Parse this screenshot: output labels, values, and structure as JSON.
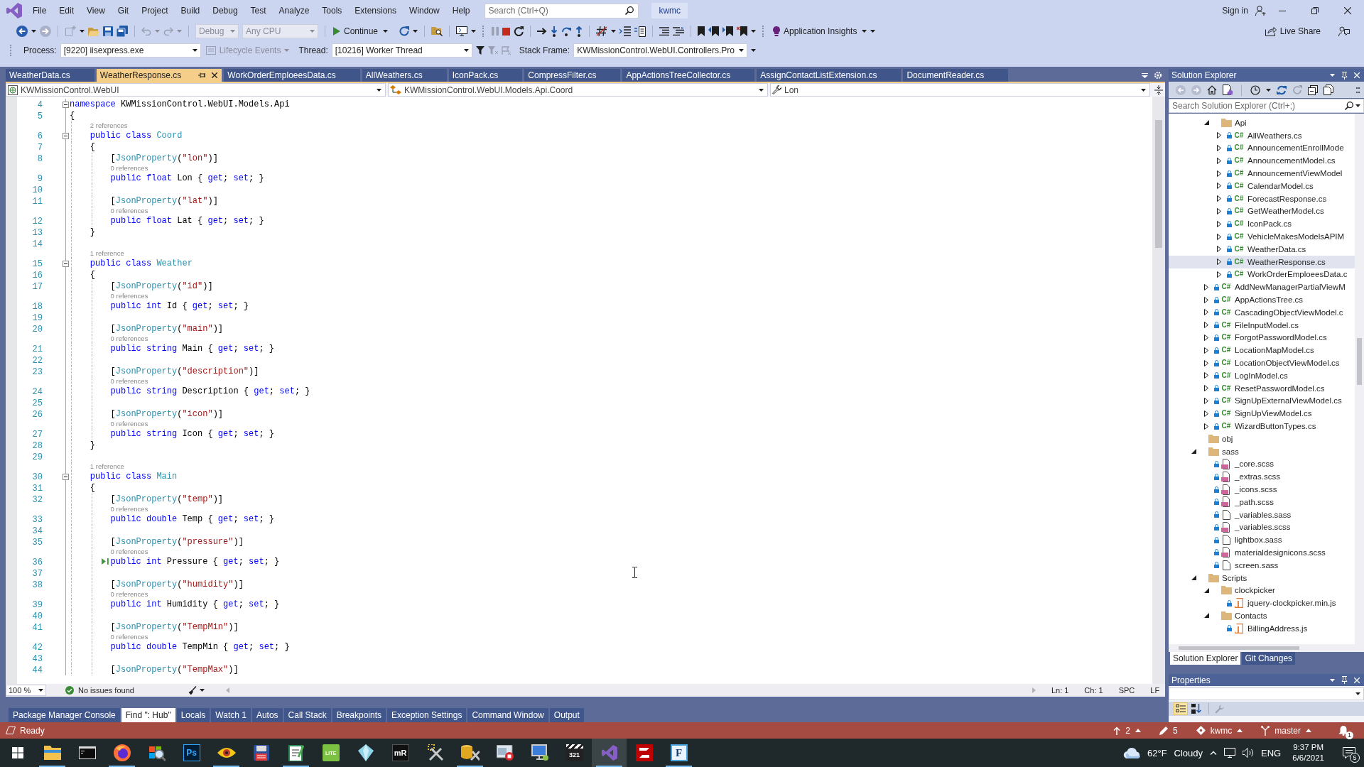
{
  "title_bar": {
    "menu": [
      "File",
      "Edit",
      "View",
      "Git",
      "Project",
      "Build",
      "Debug",
      "Test",
      "Analyze",
      "Tools",
      "Extensions",
      "Window",
      "Help"
    ],
    "search": {
      "placeholder": "Search (Ctrl+Q)"
    },
    "solution_name": "kwmc",
    "sign_in": "Sign in"
  },
  "toolbar": {
    "configuration": {
      "value": "Debug",
      "disabled": true
    },
    "platform": {
      "value": "Any CPU",
      "disabled": true
    },
    "continue": "Continue",
    "insights": "Application Insights",
    "live_share": "Live Share"
  },
  "debug_location": {
    "process_label": "Process:",
    "process": "[9220] iisexpress.exe",
    "lifecycle_events": {
      "label": "Lifecycle Events",
      "disabled": true
    },
    "thread_label": "Thread:",
    "thread": "[10216] Worker Thread",
    "stack_frame_label": "Stack Frame:",
    "stack_frame": "KWMissionControl.WebUI.Controllers.Pro"
  },
  "document_tabs": [
    {
      "label": "WeatherData.cs",
      "selected": false
    },
    {
      "label": "WeatherResponse.cs",
      "selected": true
    },
    {
      "label": "WorkOrderEmploeesData.cs",
      "selected": false
    },
    {
      "label": "AllWeathers.cs",
      "selected": false
    },
    {
      "label": "IconPack.cs",
      "selected": false
    },
    {
      "label": "CompressFilter.cs",
      "selected": false
    },
    {
      "label": "AppActionsTreeCollector.cs",
      "selected": false
    },
    {
      "label": "AssignContactListExtension.cs",
      "selected": false
    },
    {
      "label": "DocumentReader.cs",
      "selected": false
    }
  ],
  "navigation_bar": {
    "project": "KWMissionControl.WebUI",
    "type": "KWMissionControl.WebUI.Models.Api.Coord",
    "member": "Lon"
  },
  "editor": {
    "lines": [
      {
        "number": "4",
        "fold": true,
        "run_to_click": false,
        "tokens": [
          {
            "kind": "keyword",
            "text": "namespace"
          },
          {
            "kind": "plain",
            "text": " KWMissionControl.WebUI.Models.Api"
          }
        ]
      },
      {
        "number": "5",
        "fold": false,
        "run_to_click": false,
        "tokens": [
          {
            "kind": "plain",
            "text": "{"
          }
        ]
      },
      {
        "number": "6",
        "lens": "2 references",
        "fold": true,
        "run_to_click": false,
        "tokens": [
          {
            "kind": "keyword",
            "text": "    public class "
          },
          {
            "kind": "type",
            "text": "Coord"
          }
        ]
      },
      {
        "number": "7",
        "fold": false,
        "run_to_click": false,
        "tokens": [
          {
            "kind": "plain",
            "text": "    {"
          }
        ]
      },
      {
        "number": "8",
        "fold": false,
        "run_to_click": false,
        "tokens": [
          {
            "kind": "plain",
            "text": "        ["
          },
          {
            "kind": "type",
            "text": "JsonProperty"
          },
          {
            "kind": "plain",
            "text": "("
          },
          {
            "kind": "string",
            "text": "\"lon\""
          },
          {
            "kind": "plain",
            "text": ")]"
          }
        ]
      },
      {
        "number": "9",
        "lens": "0 references",
        "fold": false,
        "run_to_click": false,
        "tokens": [
          {
            "kind": "keyword",
            "text": "        public float"
          },
          {
            "kind": "plain",
            "text": " Lon { "
          },
          {
            "kind": "keyword",
            "text": "get"
          },
          {
            "kind": "plain",
            "text": "; "
          },
          {
            "kind": "keyword",
            "text": "set"
          },
          {
            "kind": "plain",
            "text": "; }"
          }
        ]
      },
      {
        "number": "10",
        "fold": false,
        "run_to_click": false
      },
      {
        "number": "11",
        "fold": false,
        "run_to_click": false,
        "tokens": [
          {
            "kind": "plain",
            "text": "        ["
          },
          {
            "kind": "type",
            "text": "JsonProperty"
          },
          {
            "kind": "plain",
            "text": "("
          },
          {
            "kind": "string",
            "text": "\"lat\""
          },
          {
            "kind": "plain",
            "text": ")]"
          }
        ]
      },
      {
        "number": "12",
        "lens": "0 references",
        "fold": false,
        "run_to_click": false,
        "tokens": [
          {
            "kind": "keyword",
            "text": "        public float"
          },
          {
            "kind": "plain",
            "text": " Lat { "
          },
          {
            "kind": "keyword",
            "text": "get"
          },
          {
            "kind": "plain",
            "text": "; "
          },
          {
            "kind": "keyword",
            "text": "set"
          },
          {
            "kind": "plain",
            "text": "; }"
          }
        ]
      },
      {
        "number": "13",
        "fold": false,
        "run_to_click": false,
        "tokens": [
          {
            "kind": "plain",
            "text": "    }"
          }
        ]
      },
      {
        "number": "14",
        "fold": false,
        "run_to_click": false
      },
      {
        "number": "15",
        "lens": "1 reference",
        "fold": true,
        "run_to_click": false,
        "tokens": [
          {
            "kind": "keyword",
            "text": "    public class "
          },
          {
            "kind": "type",
            "text": "Weather"
          }
        ]
      },
      {
        "number": "16",
        "fold": false,
        "run_to_click": false,
        "tokens": [
          {
            "kind": "plain",
            "text": "    {"
          }
        ]
      },
      {
        "number": "17",
        "fold": false,
        "run_to_click": false,
        "tokens": [
          {
            "kind": "plain",
            "text": "        ["
          },
          {
            "kind": "type",
            "text": "JsonProperty"
          },
          {
            "kind": "plain",
            "text": "("
          },
          {
            "kind": "string",
            "text": "\"id\""
          },
          {
            "kind": "plain",
            "text": ")]"
          }
        ]
      },
      {
        "number": "18",
        "lens": "0 references",
        "fold": false,
        "run_to_click": false,
        "tokens": [
          {
            "kind": "keyword",
            "text": "        public int"
          },
          {
            "kind": "plain",
            "text": " Id { "
          },
          {
            "kind": "keyword",
            "text": "get"
          },
          {
            "kind": "plain",
            "text": "; "
          },
          {
            "kind": "keyword",
            "text": "set"
          },
          {
            "kind": "plain",
            "text": "; }"
          }
        ]
      },
      {
        "number": "19",
        "fold": false,
        "run_to_click": false
      },
      {
        "number": "20",
        "fold": false,
        "run_to_click": false,
        "tokens": [
          {
            "kind": "plain",
            "text": "        ["
          },
          {
            "kind": "type",
            "text": "JsonProperty"
          },
          {
            "kind": "plain",
            "text": "("
          },
          {
            "kind": "string",
            "text": "\"main\""
          },
          {
            "kind": "plain",
            "text": ")]"
          }
        ]
      },
      {
        "number": "21",
        "lens": "0 references",
        "fold": false,
        "run_to_click": false,
        "tokens": [
          {
            "kind": "keyword",
            "text": "        public string"
          },
          {
            "kind": "plain",
            "text": " Main { "
          },
          {
            "kind": "keyword",
            "text": "get"
          },
          {
            "kind": "plain",
            "text": "; "
          },
          {
            "kind": "keyword",
            "text": "set"
          },
          {
            "kind": "plain",
            "text": "; }"
          }
        ]
      },
      {
        "number": "22",
        "fold": false,
        "run_to_click": false
      },
      {
        "number": "23",
        "fold": false,
        "run_to_click": false,
        "tokens": [
          {
            "kind": "plain",
            "text": "        ["
          },
          {
            "kind": "type",
            "text": "JsonProperty"
          },
          {
            "kind": "plain",
            "text": "("
          },
          {
            "kind": "string",
            "text": "\"description\""
          },
          {
            "kind": "plain",
            "text": ")]"
          }
        ]
      },
      {
        "number": "24",
        "lens": "0 references",
        "fold": false,
        "run_to_click": false,
        "tokens": [
          {
            "kind": "keyword",
            "text": "        public string"
          },
          {
            "kind": "plain",
            "text": " Description { "
          },
          {
            "kind": "keyword",
            "text": "get"
          },
          {
            "kind": "plain",
            "text": "; "
          },
          {
            "kind": "keyword",
            "text": "set"
          },
          {
            "kind": "plain",
            "text": "; }"
          }
        ]
      },
      {
        "number": "25",
        "fold": false,
        "run_to_click": false
      },
      {
        "number": "26",
        "fold": false,
        "run_to_click": false,
        "tokens": [
          {
            "kind": "plain",
            "text": "        ["
          },
          {
            "kind": "type",
            "text": "JsonProperty"
          },
          {
            "kind": "plain",
            "text": "("
          },
          {
            "kind": "string",
            "text": "\"icon\""
          },
          {
            "kind": "plain",
            "text": ")]"
          }
        ]
      },
      {
        "number": "27",
        "lens": "0 references",
        "fold": false,
        "run_to_click": false,
        "tokens": [
          {
            "kind": "keyword",
            "text": "        public string"
          },
          {
            "kind": "plain",
            "text": " Icon { "
          },
          {
            "kind": "keyword",
            "text": "get"
          },
          {
            "kind": "plain",
            "text": "; "
          },
          {
            "kind": "keyword",
            "text": "set"
          },
          {
            "kind": "plain",
            "text": "; }"
          }
        ]
      },
      {
        "number": "28",
        "fold": false,
        "run_to_click": false,
        "tokens": [
          {
            "kind": "plain",
            "text": "    }"
          }
        ]
      },
      {
        "number": "29",
        "fold": false,
        "run_to_click": false
      },
      {
        "number": "30",
        "lens": "1 reference",
        "fold": true,
        "run_to_click": false,
        "tokens": [
          {
            "kind": "keyword",
            "text": "    public class "
          },
          {
            "kind": "type",
            "text": "Main"
          }
        ]
      },
      {
        "number": "31",
        "fold": false,
        "run_to_click": false,
        "tokens": [
          {
            "kind": "plain",
            "text": "    {"
          }
        ]
      },
      {
        "number": "32",
        "fold": false,
        "run_to_click": false,
        "tokens": [
          {
            "kind": "plain",
            "text": "        ["
          },
          {
            "kind": "type",
            "text": "JsonProperty"
          },
          {
            "kind": "plain",
            "text": "("
          },
          {
            "kind": "string",
            "text": "\"temp\""
          },
          {
            "kind": "plain",
            "text": ")]"
          }
        ]
      },
      {
        "number": "33",
        "lens": "0 references",
        "fold": false,
        "run_to_click": false,
        "tokens": [
          {
            "kind": "keyword",
            "text": "        public double"
          },
          {
            "kind": "plain",
            "text": " Temp { "
          },
          {
            "kind": "keyword",
            "text": "get"
          },
          {
            "kind": "plain",
            "text": "; "
          },
          {
            "kind": "keyword",
            "text": "set"
          },
          {
            "kind": "plain",
            "text": "; }"
          }
        ]
      },
      {
        "number": "34",
        "fold": false,
        "run_to_click": false
      },
      {
        "number": "35",
        "fold": false,
        "run_to_click": false,
        "tokens": [
          {
            "kind": "plain",
            "text": "        ["
          },
          {
            "kind": "type",
            "text": "JsonProperty"
          },
          {
            "kind": "plain",
            "text": "("
          },
          {
            "kind": "string",
            "text": "\"pressure\""
          },
          {
            "kind": "plain",
            "text": ")]"
          }
        ]
      },
      {
        "number": "36",
        "lens": "0 references",
        "fold": false,
        "run_to_click": true,
        "tokens": [
          {
            "kind": "keyword",
            "text": "        public int"
          },
          {
            "kind": "plain",
            "text": " Pressure { "
          },
          {
            "kind": "keyword",
            "text": "get"
          },
          {
            "kind": "plain",
            "text": "; "
          },
          {
            "kind": "keyword",
            "text": "set"
          },
          {
            "kind": "plain",
            "text": "; }"
          }
        ]
      },
      {
        "number": "37",
        "fold": false,
        "run_to_click": false
      },
      {
        "number": "38",
        "fold": false,
        "run_to_click": false,
        "tokens": [
          {
            "kind": "plain",
            "text": "        ["
          },
          {
            "kind": "type",
            "text": "JsonProperty"
          },
          {
            "kind": "plain",
            "text": "("
          },
          {
            "kind": "string",
            "text": "\"humidity\""
          },
          {
            "kind": "plain",
            "text": ")]"
          }
        ]
      },
      {
        "number": "39",
        "lens": "0 references",
        "fold": false,
        "run_to_click": false,
        "tokens": [
          {
            "kind": "keyword",
            "text": "        public int"
          },
          {
            "kind": "plain",
            "text": " Humidity { "
          },
          {
            "kind": "keyword",
            "text": "get"
          },
          {
            "kind": "plain",
            "text": "; "
          },
          {
            "kind": "keyword",
            "text": "set"
          },
          {
            "kind": "plain",
            "text": "; }"
          }
        ]
      },
      {
        "number": "40",
        "fold": false,
        "run_to_click": false
      },
      {
        "number": "41",
        "fold": false,
        "run_to_click": false,
        "tokens": [
          {
            "kind": "plain",
            "text": "        ["
          },
          {
            "kind": "type",
            "text": "JsonProperty"
          },
          {
            "kind": "plain",
            "text": "("
          },
          {
            "kind": "string",
            "text": "\"TempMin\""
          },
          {
            "kind": "plain",
            "text": ")]"
          }
        ]
      },
      {
        "number": "42",
        "lens": "0 references",
        "fold": false,
        "run_to_click": false,
        "tokens": [
          {
            "kind": "keyword",
            "text": "        public double"
          },
          {
            "kind": "plain",
            "text": " TempMin { "
          },
          {
            "kind": "keyword",
            "text": "get"
          },
          {
            "kind": "plain",
            "text": "; "
          },
          {
            "kind": "keyword",
            "text": "set"
          },
          {
            "kind": "plain",
            "text": "; }"
          }
        ]
      },
      {
        "number": "43",
        "fold": false,
        "run_to_click": false
      },
      {
        "number": "44",
        "fold": false,
        "run_to_click": false,
        "tokens": [
          {
            "kind": "plain",
            "text": "        ["
          },
          {
            "kind": "type",
            "text": "JsonProperty"
          },
          {
            "kind": "plain",
            "text": "("
          },
          {
            "kind": "string",
            "text": "\"TempMax\""
          },
          {
            "kind": "plain",
            "text": ")]"
          }
        ]
      }
    ]
  },
  "editor_status": {
    "zoom": "100 %",
    "issues": "No issues found",
    "line": "Ln: 1",
    "column": "Ch: 1",
    "whitespace": "SPC",
    "line_ending": "LF"
  },
  "tool_tabs": [
    {
      "label": "Package Manager Console",
      "selected": false
    },
    {
      "label": "Find \": Hub\"",
      "selected": true
    },
    {
      "label": "Locals",
      "selected": false
    },
    {
      "label": "Watch 1",
      "selected": false
    },
    {
      "label": "Autos",
      "selected": false
    },
    {
      "label": "Call Stack",
      "selected": false
    },
    {
      "label": "Breakpoints",
      "selected": false
    },
    {
      "label": "Exception Settings",
      "selected": false
    },
    {
      "label": "Command Window",
      "selected": false
    },
    {
      "label": "Output",
      "selected": false
    }
  ],
  "solution_explorer": {
    "title": "Solution Explorer",
    "search": {
      "placeholder": "Search Solution Explorer (Ctrl+;)"
    },
    "tree": [
      {
        "children": [
          {
            "label": "Api",
            "kind": "folder",
            "expanded": true,
            "selected": false,
            "children": [
              {
                "label": "AllWeathers.cs",
                "kind": "csharp",
                "tag": "C#",
                "expanded": false,
                "selected": false
              },
              {
                "label": "AnnouncementEnrollMode",
                "kind": "csharp",
                "tag": "C#",
                "expanded": false,
                "selected": false
              },
              {
                "label": "AnnouncementModel.cs",
                "kind": "csharp",
                "tag": "C#",
                "expanded": false,
                "selected": false
              },
              {
                "label": "AnnouncementViewModel",
                "kind": "csharp",
                "tag": "C#",
                "expanded": false,
                "selected": false
              },
              {
                "label": "CalendarModel.cs",
                "kind": "csharp",
                "tag": "C#",
                "expanded": false,
                "selected": false
              },
              {
                "label": "ForecastResponse.cs",
                "kind": "csharp",
                "tag": "C#",
                "expanded": false,
                "selected": false
              },
              {
                "label": "GetWeatherModel.cs",
                "kind": "csharp",
                "tag": "C#",
                "expanded": false,
                "selected": false
              },
              {
                "label": "IconPack.cs",
                "kind": "csharp",
                "tag": "C#",
                "expanded": false,
                "selected": false
              },
              {
                "label": "VehicleMakesModelsAPIM",
                "kind": "csharp",
                "tag": "C#",
                "expanded": false,
                "selected": false
              },
              {
                "label": "WeatherData.cs",
                "kind": "csharp",
                "tag": "C#",
                "expanded": false,
                "selected": false
              },
              {
                "label": "WeatherResponse.cs",
                "kind": "csharp",
                "tag": "C#",
                "expanded": false,
                "selected": true
              },
              {
                "label": "WorkOrderEmploeesData.c",
                "kind": "csharp",
                "tag": "C#",
                "expanded": false,
                "selected": false
              }
            ]
          },
          {
            "label": "AddNewManagerPartialViewM",
            "kind": "csharp",
            "tag": "C#",
            "expanded": false,
            "selected": false
          },
          {
            "label": "AppActionsTree.cs",
            "kind": "csharp",
            "tag": "C#",
            "expanded": false,
            "selected": false
          },
          {
            "label": "CascadingObjectViewModel.c",
            "kind": "csharp",
            "tag": "C#",
            "expanded": false,
            "selected": false
          },
          {
            "label": "FileInputModel.cs",
            "kind": "csharp",
            "tag": "C#",
            "expanded": false,
            "selected": false
          },
          {
            "label": "ForgotPasswordModel.cs",
            "kind": "csharp",
            "tag": "C#",
            "expanded": false,
            "selected": false
          },
          {
            "label": "LocationMapModel.cs",
            "kind": "csharp",
            "tag": "C#",
            "expanded": false,
            "selected": false
          },
          {
            "label": "LocationObjectViewModel.cs",
            "kind": "csharp",
            "tag": "C#",
            "expanded": false,
            "selected": false
          },
          {
            "label": "LogInModel.cs",
            "kind": "csharp",
            "tag": "C#",
            "expanded": false,
            "selected": false
          },
          {
            "label": "ResetPasswordModel.cs",
            "kind": "csharp",
            "tag": "C#",
            "expanded": false,
            "selected": false
          },
          {
            "label": "SignUpExternalViewModel.cs",
            "kind": "csharp",
            "tag": "C#",
            "expanded": false,
            "selected": false
          },
          {
            "label": "SignUpViewModel.cs",
            "kind": "csharp",
            "tag": "C#",
            "expanded": false,
            "selected": false
          },
          {
            "label": "WizardButtonTypes.cs",
            "kind": "csharp",
            "tag": "C#",
            "expanded": false,
            "selected": false
          }
        ]
      },
      {
        "label": "obj",
        "kind": "folder",
        "selected": false
      },
      {
        "label": "sass",
        "kind": "folder",
        "expanded": true,
        "selected": false,
        "children": [
          {
            "label": "_core.scss",
            "kind": "sass",
            "selected": false
          },
          {
            "label": "_extras.scss",
            "kind": "sass",
            "selected": false
          },
          {
            "label": "_icons.scss",
            "kind": "sass",
            "selected": false
          },
          {
            "label": "_path.scss",
            "kind": "sass",
            "selected": false
          },
          {
            "label": "_variables.sass",
            "kind": "document",
            "selected": false
          },
          {
            "label": "_variables.scss",
            "kind": "sass",
            "selected": false
          },
          {
            "label": "lightbox.sass",
            "kind": "document",
            "selected": false
          },
          {
            "label": "materialdesignicons.scss",
            "kind": "sass",
            "selected": false
          },
          {
            "label": "screen.sass",
            "kind": "document",
            "selected": false
          }
        ]
      },
      {
        "label": "Scripts",
        "kind": "folder",
        "expanded": true,
        "selected": false,
        "children": [
          {
            "label": "clockpicker",
            "kind": "folder",
            "expanded": true,
            "selected": false,
            "children": [
              {
                "label": "jquery-clockpicker.min.js",
                "kind": "script",
                "selected": false
              }
            ]
          },
          {
            "label": "Contacts",
            "kind": "folder",
            "expanded": true,
            "selected": false,
            "children": [
              {
                "label": "BillingAddress.js",
                "kind": "script",
                "selected": false
              }
            ]
          }
        ]
      }
    ],
    "tabs": [
      {
        "label": "Solution Explorer",
        "selected": true
      },
      {
        "label": "Git Changes",
        "selected": false
      }
    ]
  },
  "properties": {
    "title": "Properties",
    "view_buttons": [
      {
        "kind": "categorized",
        "selected": true
      },
      {
        "kind": "alphabetical",
        "selected": false
      }
    ]
  },
  "status_bar": {
    "text": "Ready",
    "pushes": "2",
    "changes": "5",
    "repository": "kwmc",
    "branch": "master",
    "notifications": "1"
  },
  "taskbar": {
    "apps": [
      {
        "kind": "folder",
        "running": true,
        "selected": false
      },
      {
        "kind": "terminal",
        "running": false,
        "selected": false
      },
      {
        "kind": "browser",
        "running": true,
        "selected": false
      },
      {
        "kind": "magnifier",
        "running": false,
        "selected": false
      },
      {
        "kind": "navytile",
        "glyph": "Ps",
        "running": false,
        "selected": false
      },
      {
        "kind": "eye",
        "running": true,
        "selected": false
      },
      {
        "kind": "floppy",
        "running": false,
        "selected": false
      },
      {
        "kind": "notepad",
        "running": true,
        "selected": false
      },
      {
        "kind": "litenote",
        "glyph": "LITE",
        "running": false,
        "selected": false
      },
      {
        "kind": "crystal",
        "running": false,
        "selected": false
      },
      {
        "kind": "darktile",
        "glyph": "mR",
        "running": false,
        "selected": false
      },
      {
        "kind": "tools",
        "running": false,
        "selected": false
      },
      {
        "kind": "dbtools",
        "running": true,
        "selected": false
      },
      {
        "kind": "windowstop",
        "running": false,
        "selected": false
      },
      {
        "kind": "computer",
        "running": false,
        "selected": false
      },
      {
        "kind": "clapper",
        "glyph": "321",
        "running": false,
        "selected": false
      },
      {
        "kind": "ribbon",
        "running": true,
        "selected": true
      },
      {
        "kind": "zigzag",
        "running": false,
        "selected": false
      },
      {
        "kind": "frame",
        "glyph": "F",
        "running": true,
        "selected": false
      }
    ],
    "weather": {
      "temperature": "62°F",
      "condition": "Cloudy"
    },
    "language": "ENG",
    "time": "9:37 PM",
    "date": "6/6/2021",
    "notifications": "5"
  }
}
